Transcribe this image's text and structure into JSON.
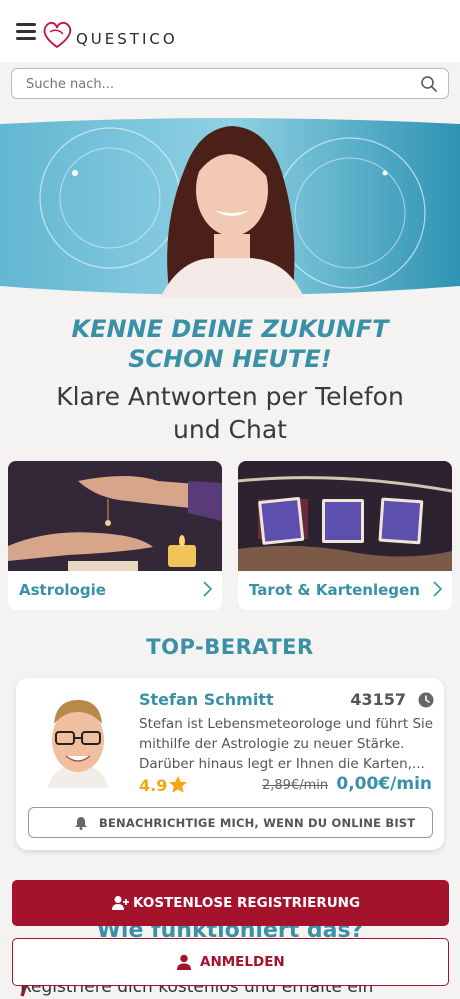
{
  "header": {
    "logo_text": "QUESTICO",
    "icons": {
      "menu": "hamburger-menu-icon",
      "logo": "heart-logo-icon"
    }
  },
  "search": {
    "placeholder": "Suche nach...",
    "value": "",
    "icon": "search-icon"
  },
  "hero": {
    "headline_line1": "KENNE DEINE ZUKUNFT",
    "headline_line2": "SCHON HEUTE!",
    "subline_line1": "Klare Antworten per Telefon",
    "subline_line2": "und Chat"
  },
  "categories": [
    {
      "label": "Astrologie",
      "icon": "chevron-right-icon"
    },
    {
      "label": "Tarot & Kartenlegen",
      "icon": "chevron-right-icon"
    }
  ],
  "top_advisors": {
    "title": "TOP-BERATER",
    "advisor": {
      "name": "Stefan Schmitt",
      "count": "43157",
      "description": "Stefan ist Lebensmeteorologe und führt Sie mithilfe der Astrologie zu neuer Stärke. Darüber hinaus legt er Ihnen die Karten,...",
      "rating": "4.9",
      "old_price": "2,89€/min",
      "new_price": "0,00€/min",
      "notify_label": "BENACHRICHTIGE MICH, WENN DU ONLINE BIST"
    }
  },
  "how": {
    "title": "Wie funktioniert das?",
    "step_text": "Registriere dich kostenlos und erhalte ein"
  },
  "cta": {
    "register_label": "KOSTENLOSE REGISTRIERUNG",
    "login_label": "ANMELDEN"
  },
  "colors": {
    "accent": "#3a90a6",
    "brand_red": "#a4122c",
    "rating": "#f3a712",
    "background": "#f5f3f2"
  }
}
